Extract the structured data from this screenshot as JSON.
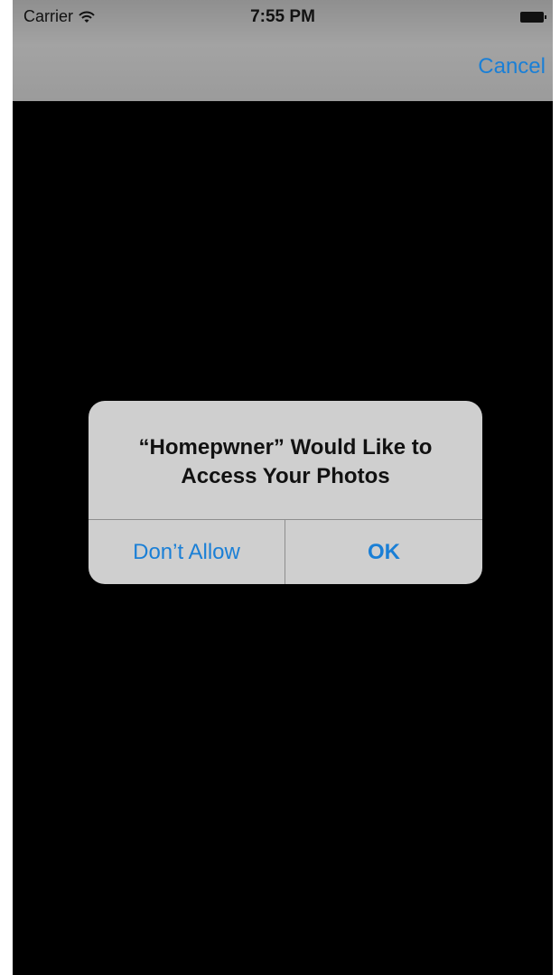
{
  "status_bar": {
    "carrier": "Carrier",
    "time": "7:55 PM",
    "icons": [
      "wifi-icon",
      "battery-icon"
    ]
  },
  "nav_bar": {
    "cancel_label": "Cancel"
  },
  "alert": {
    "title_line1": "“Homepwner” Would Like to",
    "title_line2": "Access Your Photos",
    "dont_allow_label": "Don’t Allow",
    "ok_label": "OK"
  },
  "colors": {
    "accent": "#1a7fd6",
    "screen_background": "#000000",
    "bar_background": "#9a9a9a",
    "alert_background": "#cfcfcf"
  }
}
